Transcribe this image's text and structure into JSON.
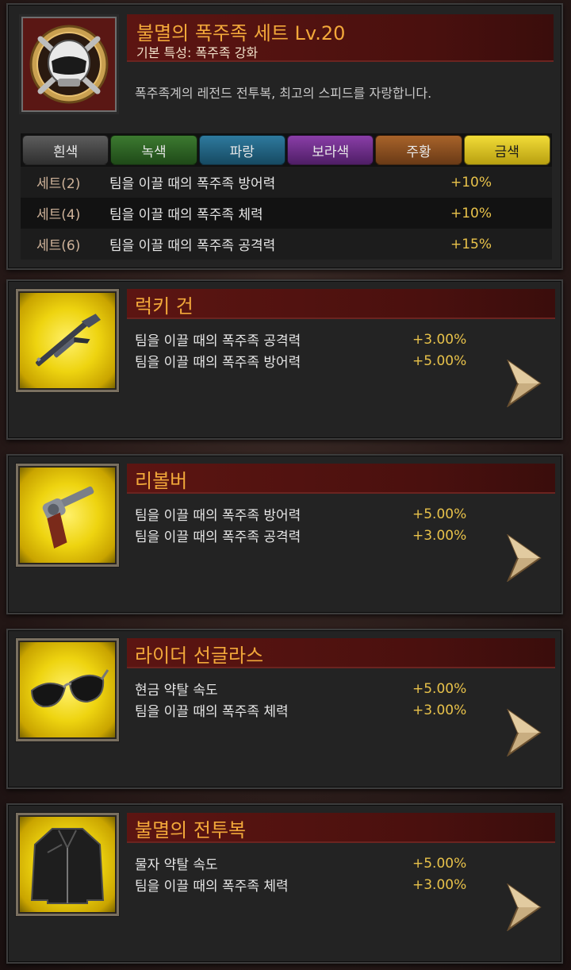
{
  "set": {
    "title": "불멸의 폭주족 세트 Lv.20",
    "subtitle": "기본 특성: 폭주족 강화",
    "description": "폭주족계의 레전드 전투복, 최고의 스피드를 자랑합니다.",
    "icon": "helmet-emblem-icon",
    "tabs": [
      {
        "label": "흰색",
        "color": "#4a4a4a"
      },
      {
        "label": "녹색",
        "color": "#2f6a26"
      },
      {
        "label": "파랑",
        "color": "#236a8c"
      },
      {
        "label": "보라색",
        "color": "#7a3498"
      },
      {
        "label": "주황",
        "color": "#8f5220"
      },
      {
        "label": "금색",
        "color": "#e2c822"
      }
    ],
    "bonuses": [
      {
        "label": "세트(2)",
        "text": "팀을 이끌 때의 폭주족 방어력",
        "value": "+10%"
      },
      {
        "label": "세트(4)",
        "text": "팀을 이끌 때의 폭주족 체력",
        "value": "+10%"
      },
      {
        "label": "세트(6)",
        "text": "팀을 이끌 때의 폭주족 공격력",
        "value": "+15%"
      }
    ]
  },
  "items": [
    {
      "name": "럭키 건",
      "icon": "shotgun-icon",
      "stats": [
        {
          "text": "팀을 이끌 때의 폭주족 공격력",
          "value": "+3.00%"
        },
        {
          "text": "팀을 이끌 때의 폭주족 방어력",
          "value": "+5.00%"
        }
      ]
    },
    {
      "name": "리볼버",
      "icon": "revolver-icon",
      "stats": [
        {
          "text": "팀을 이끌 때의 폭주족 방어력",
          "value": "+5.00%"
        },
        {
          "text": "팀을 이끌 때의 폭주족 공격력",
          "value": "+3.00%"
        }
      ]
    },
    {
      "name": "라이더 선글라스",
      "icon": "sunglasses-icon",
      "stats": [
        {
          "text": "현금 약탈 속도",
          "value": "+5.00%"
        },
        {
          "text": "팀을 이끌 때의 폭주족 체력",
          "value": "+3.00%"
        }
      ]
    },
    {
      "name": "불멸의 전투복",
      "icon": "leather-jacket-icon",
      "stats": [
        {
          "text": "물자 약탈 속도",
          "value": "+5.00%"
        },
        {
          "text": "팀을 이끌 때의 폭주족 체력",
          "value": "+3.00%"
        }
      ]
    }
  ],
  "colors": {
    "accent_gold": "#f2a83a",
    "value_gold": "#e8c24a",
    "title_bar": "#5c1512"
  }
}
